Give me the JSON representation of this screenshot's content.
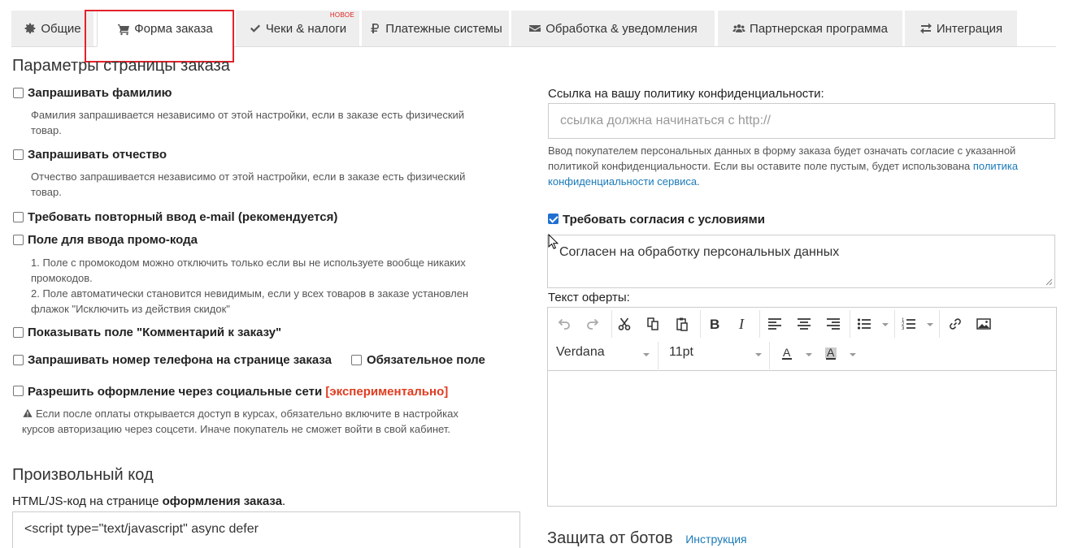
{
  "tabs": [
    {
      "label": "Общие",
      "icon": "gear-icon"
    },
    {
      "label": "Форма заказа",
      "icon": "cart-icon"
    },
    {
      "label": "Чеки & налоги",
      "icon": "check-icon",
      "badge": "НОВОЕ"
    },
    {
      "label": "Платежные системы",
      "icon": "ruble-icon"
    },
    {
      "label": "Обработка & уведомления",
      "icon": "envelope-icon"
    },
    {
      "label": "Партнерская программа",
      "icon": "users-icon"
    },
    {
      "label": "Интеграция",
      "icon": "exchange-icon"
    }
  ],
  "left": {
    "section_title": "Параметры страницы заказа",
    "options": [
      {
        "label": "Запрашивать фамилию",
        "checked": false,
        "help": [
          "Фамилия запрашивается независимо от этой настройки, если в заказе есть физический",
          "товар."
        ]
      },
      {
        "label": "Запрашивать отчество",
        "checked": false,
        "help": [
          "Отчество запрашивается независимо от этой настройки, если в заказе есть физический",
          "товар."
        ]
      },
      {
        "label": "Требовать повторный ввод e-mail (рекомендуется)",
        "checked": false
      },
      {
        "label": "Поле для ввода промо-кода",
        "checked": false,
        "help": [
          "1. Поле с промокодом можно отключить только если вы не используете вообще никаких",
          "промокодов.",
          "2. Поле автоматически становится невидимым, если у всех товаров в заказе установлен",
          "флажок \"Исключить из действия скидок\""
        ]
      },
      {
        "label": "Показывать поле \"Комментарий к заказу\"",
        "checked": false
      },
      {
        "label": "Запрашивать номер телефона на странице заказа",
        "checked": false
      },
      {
        "label": "Разрешить оформление через социальные сети",
        "checked": false,
        "tag": "[экспериментально]",
        "help": [
          "Если после оплаты открывается доступ в курсах, обязательно включите в настройках",
          "курсов авторизацию через соцсети. Иначе покупатель не сможет войти в свой кабинет."
        ]
      }
    ],
    "phone_required_label": "Обязательное поле",
    "custom_code_title": "Произвольный код",
    "custom_code_desc_prefix": "HTML/JS-код на странице ",
    "custom_code_desc_bold": "оформления заказа",
    "custom_code_desc_suffix": ".",
    "custom_code_value": "<script type=\"text/javascript\" async defer"
  },
  "right": {
    "privacy_label": "Ссылка на вашу политику конфиденциальности:",
    "privacy_placeholder": "ссылка должна начинаться с http://",
    "privacy_help_line1": "Ввод покупателем персональных данных в форму заказа будет означать согласие с указанной",
    "privacy_help_line2_prefix": "политикой конфиденциальности. Если вы оставите поле пустым, будет использована ",
    "privacy_help_link_part1": "политика",
    "privacy_help_link_part2": "конфиденциальности сервиса",
    "privacy_help_line3_suffix": ".",
    "consent_label": "Требовать согласия с условиями",
    "consent_checked": true,
    "consent_text": "Согласен на обработку персональных данных",
    "offer_label": "Текст оферты:",
    "editor": {
      "font_family": "Verdana",
      "font_size": "11pt",
      "tools": [
        "undo-icon",
        "redo-icon",
        "cut-icon",
        "copy-icon",
        "paste-icon",
        "bold-icon",
        "italic-icon",
        "align-left-icon",
        "align-center-icon",
        "align-right-icon",
        "bullet-list-icon",
        "numbered-list-icon",
        "link-icon",
        "image-icon",
        "font-color-icon",
        "background-color-icon"
      ]
    },
    "bot_section_title": "Защита от ботов",
    "bot_instructions_link": "Инструкция"
  },
  "colors": {
    "accent_link": "#1a7ab8",
    "experimental_tag": "#e03c20",
    "highlight_box": "#e3222a",
    "checkbox_checked": "#1f6fd1"
  }
}
